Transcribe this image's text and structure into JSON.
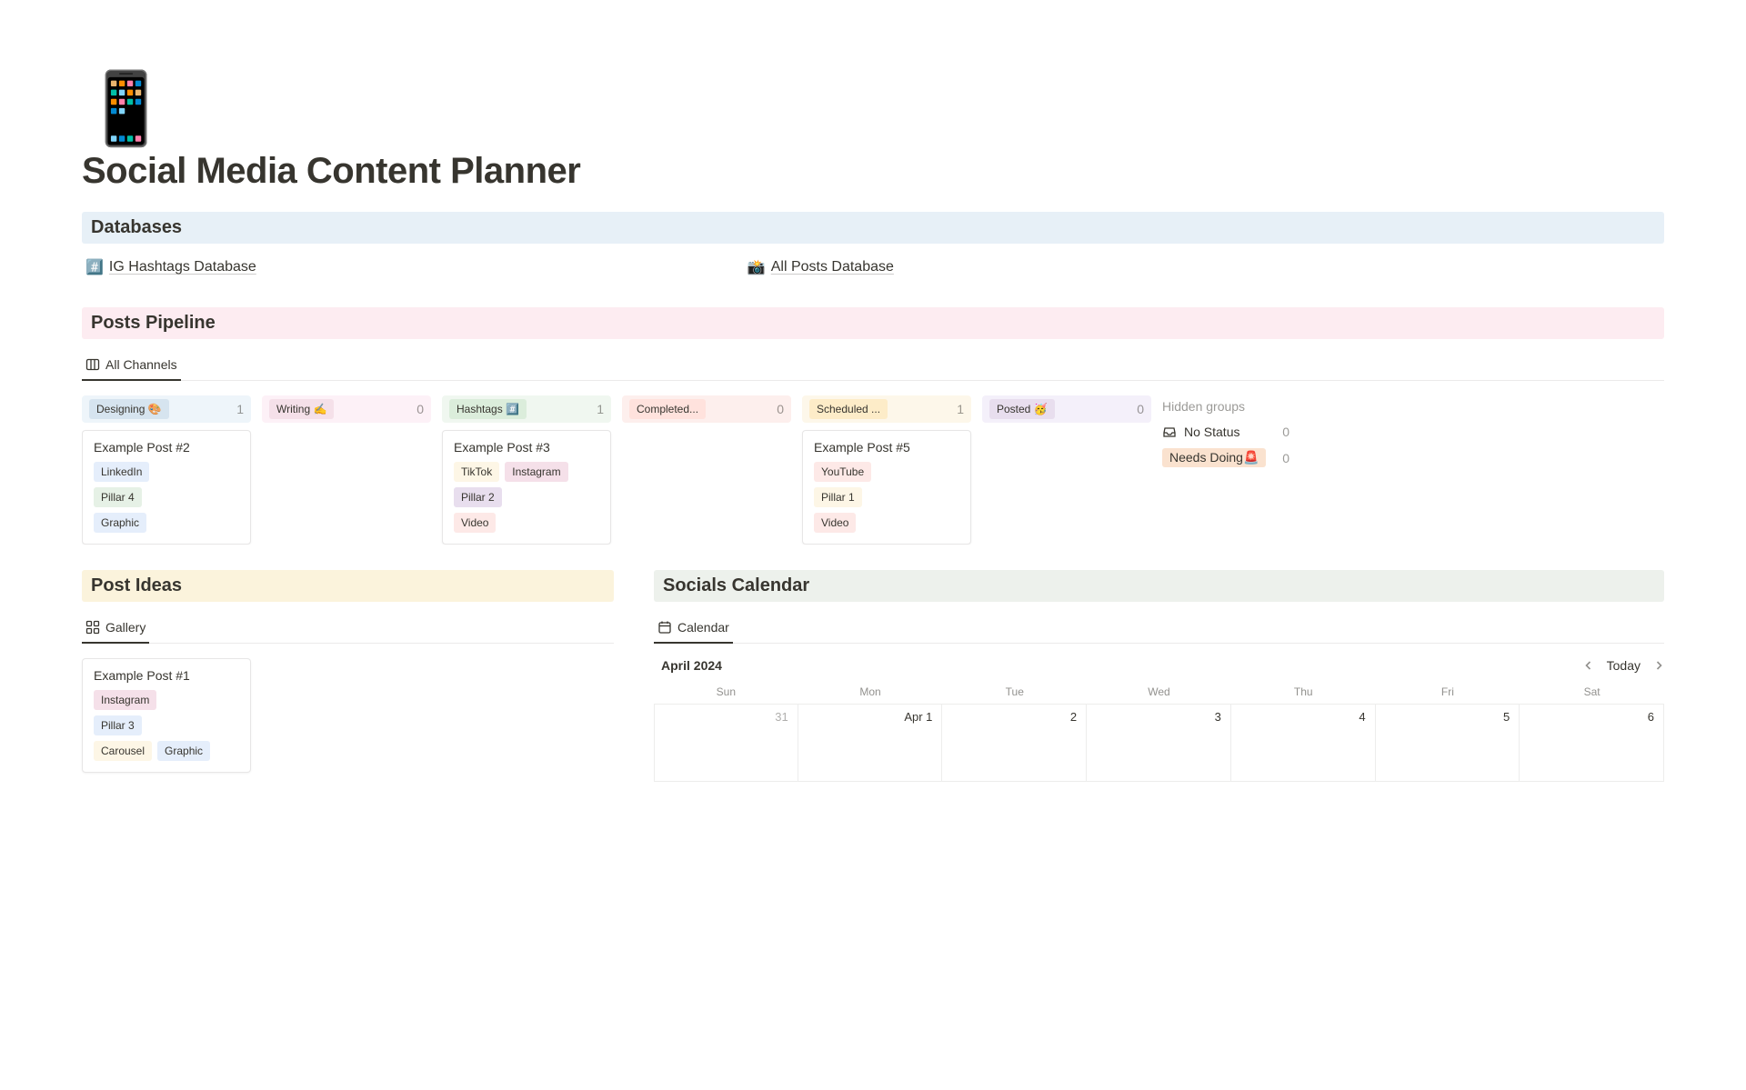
{
  "page": {
    "icon": "📱",
    "title": "Social Media Content Planner"
  },
  "sections": {
    "databases": "Databases",
    "pipeline": "Posts Pipeline",
    "ideas": "Post Ideas",
    "calendar": "Socials Calendar"
  },
  "databases": [
    {
      "icon": "#️⃣",
      "label": "IG Hashtags Database"
    },
    {
      "icon": "📸",
      "label": "All Posts Database"
    }
  ],
  "pipeline": {
    "view_tab": "All Channels",
    "columns": [
      {
        "label": "Designing 🎨",
        "count": "1",
        "bg": "bg-designing",
        "chip": "c-blue",
        "card": {
          "title": "Example Post #2",
          "rows": [
            [
              {
                "text": "LinkedIn",
                "cls": "c-blueL"
              }
            ],
            [
              {
                "text": "Pillar 4",
                "cls": "c-greenL"
              }
            ],
            [
              {
                "text": "Graphic",
                "cls": "c-blueL"
              }
            ]
          ]
        }
      },
      {
        "label": "Writing ✍️",
        "count": "0",
        "bg": "bg-writing",
        "chip": "c-pinkL",
        "card": null
      },
      {
        "label": "Hashtags #️⃣",
        "count": "1",
        "bg": "bg-hashtags",
        "chip": "c-green",
        "card": {
          "title": "Example Post #3",
          "rows": [
            [
              {
                "text": "TikTok",
                "cls": "c-yellowL"
              },
              {
                "text": "Instagram",
                "cls": "c-pinkL"
              }
            ],
            [
              {
                "text": "Pillar 2",
                "cls": "c-purple"
              }
            ],
            [
              {
                "text": "Video",
                "cls": "c-redL"
              }
            ]
          ]
        }
      },
      {
        "label": "Completed...",
        "count": "0",
        "bg": "bg-completed",
        "chip": "c-red",
        "card": null
      },
      {
        "label": "Scheduled ...",
        "count": "1",
        "bg": "bg-scheduled",
        "chip": "c-yellow",
        "card": {
          "title": "Example Post #5",
          "rows": [
            [
              {
                "text": "YouTube",
                "cls": "c-redL"
              }
            ],
            [
              {
                "text": "Pillar 1",
                "cls": "c-yellowL"
              }
            ],
            [
              {
                "text": "Video",
                "cls": "c-redL"
              }
            ]
          ]
        }
      },
      {
        "label": "Posted 🥳",
        "count": "0",
        "bg": "bg-posted",
        "chip": "c-purple",
        "card": null
      }
    ],
    "hidden": {
      "title": "Hidden groups",
      "items": [
        {
          "label": "No Status",
          "count": "0",
          "chip": ""
        },
        {
          "label": "Needs Doing🚨",
          "count": "0",
          "chip": "c-orange"
        }
      ]
    }
  },
  "ideas": {
    "view_tab": "Gallery",
    "card": {
      "title": "Example Post #1",
      "rows": [
        [
          {
            "text": "Instagram",
            "cls": "c-pinkL"
          }
        ],
        [
          {
            "text": "Pillar 3",
            "cls": "c-blueL"
          }
        ],
        [
          {
            "text": "Carousel",
            "cls": "c-yellowL"
          },
          {
            "text": "Graphic",
            "cls": "c-blueL"
          }
        ]
      ]
    }
  },
  "calendar": {
    "view_tab": "Calendar",
    "month": "April 2024",
    "today": "Today",
    "dow": [
      "Sun",
      "Mon",
      "Tue",
      "Wed",
      "Thu",
      "Fri",
      "Sat"
    ],
    "cells": [
      {
        "t": "31",
        "dim": true
      },
      {
        "t": "Apr 1"
      },
      {
        "t": "2"
      },
      {
        "t": "3"
      },
      {
        "t": "4"
      },
      {
        "t": "5"
      },
      {
        "t": "6"
      }
    ]
  }
}
